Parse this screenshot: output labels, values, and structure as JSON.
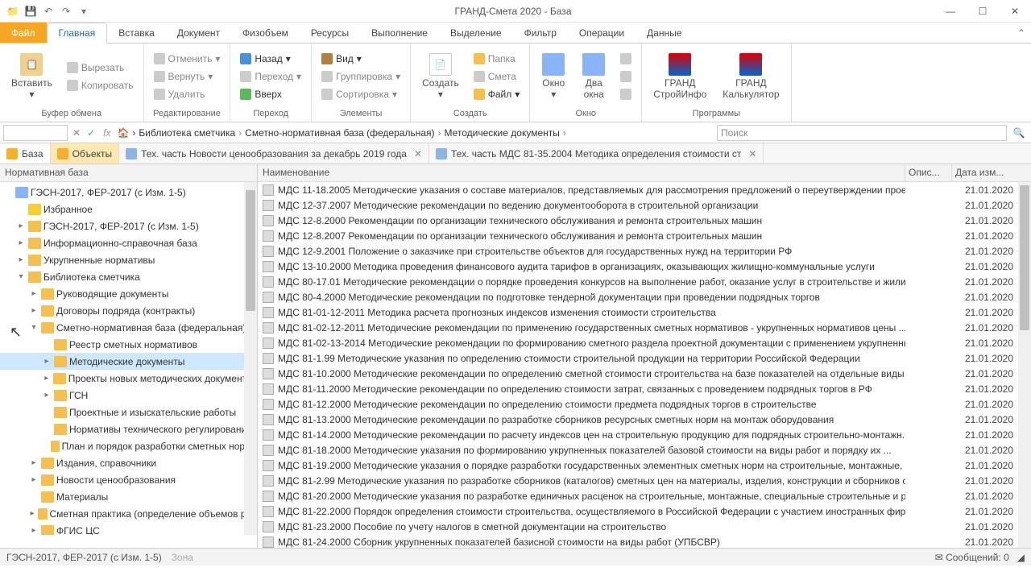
{
  "title": "ГРАНД-Смета 2020 - База",
  "ribbon_tabs": {
    "file": "Файл",
    "main": "Главная",
    "insert": "Вставка",
    "document": "Документ",
    "physvol": "Физобъем",
    "resources": "Ресурсы",
    "execute": "Выполнение",
    "select": "Выделение",
    "filter": "Фильтр",
    "ops": "Операции",
    "data": "Данные"
  },
  "ribbon": {
    "paste": "Вставить",
    "cut": "Вырезать",
    "copy": "Копировать",
    "clipboard": "Буфер обмена",
    "undo": "Отменить",
    "redo": "Вернуть",
    "delete": "Удалить",
    "editing": "Редактирование",
    "back": "Назад",
    "forward": "Переход",
    "up": "Вверх",
    "transfer": "Переход",
    "view": "Вид",
    "group": "Группировка",
    "sort": "Сортировка",
    "elements": "Элементы",
    "create": "Создать",
    "folder": "Папка",
    "smeta": "Смета",
    "file_btn": "Файл",
    "create_grp": "Создать",
    "window": "Окно",
    "two_win": "Два\nокна",
    "window_grp": "Окно",
    "grand_info": "ГРАНД\nСтройИнфо",
    "grand_calc": "ГРАНД\nКалькулятор",
    "programs": "Программы"
  },
  "breadcrumb": {
    "p1": "Библиотека сметчика",
    "p2": "Сметно-нормативная база (федеральная)",
    "p3": "Методические документы"
  },
  "search_placeholder": "Поиск",
  "view_tabs": {
    "base": "База",
    "objects": "Объекты"
  },
  "doc_tabs": {
    "t1": "Тех. часть Новости ценообразования за декабрь 2019 года",
    "t2": "Тех. часть МДС 81-35.2004 Методика определения стоимости ст"
  },
  "tree_header": "Нормативная база",
  "tree": [
    {
      "l": 0,
      "icon": "db",
      "exp": "",
      "t": "ГЭСН-2017, ФЕР-2017 (с Изм. 1-5)"
    },
    {
      "l": 1,
      "icon": "star",
      "exp": "",
      "t": "Избранное"
    },
    {
      "l": 1,
      "icon": "f",
      "exp": "▸",
      "t": "ГЭСН-2017, ФЕР-2017 (с Изм. 1-5)"
    },
    {
      "l": 1,
      "icon": "f",
      "exp": "▸",
      "t": "Информационно-справочная база"
    },
    {
      "l": 1,
      "icon": "f",
      "exp": "▸",
      "t": "Укрупненные нормативы"
    },
    {
      "l": 1,
      "icon": "f",
      "exp": "▾",
      "t": "Библиотека сметчика"
    },
    {
      "l": 2,
      "icon": "f",
      "exp": "▸",
      "t": "Руководящие документы"
    },
    {
      "l": 2,
      "icon": "f",
      "exp": "▸",
      "t": "Договоры подряда (контракты)"
    },
    {
      "l": 2,
      "icon": "f",
      "exp": "▾",
      "t": "Сметно-нормативная база (федеральная)",
      "sel": true
    },
    {
      "l": 3,
      "icon": "f",
      "exp": "",
      "t": "Реестр сметных нормативов"
    },
    {
      "l": 3,
      "icon": "f",
      "exp": "▸",
      "t": "Методические документы",
      "sel": true
    },
    {
      "l": 3,
      "icon": "f",
      "exp": "▸",
      "t": "Проекты новых методических документов"
    },
    {
      "l": 3,
      "icon": "f",
      "exp": "▸",
      "t": "ГСН"
    },
    {
      "l": 3,
      "icon": "f",
      "exp": "",
      "t": "Проектные и изыскательские работы"
    },
    {
      "l": 3,
      "icon": "f",
      "exp": "",
      "t": "Нормативы технического регулирования"
    },
    {
      "l": 3,
      "icon": "f",
      "exp": "",
      "t": "План и порядок разработки сметных норма"
    },
    {
      "l": 2,
      "icon": "f",
      "exp": "▸",
      "t": "Издания, справочники"
    },
    {
      "l": 2,
      "icon": "f",
      "exp": "▸",
      "t": "Новости ценообразования"
    },
    {
      "l": 2,
      "icon": "f",
      "exp": "",
      "t": "Материалы"
    },
    {
      "l": 2,
      "icon": "f",
      "exp": "▸",
      "t": "Сметная практика (определение объемов раб"
    },
    {
      "l": 2,
      "icon": "f",
      "exp": "▸",
      "t": "ФГИС ЦС"
    }
  ],
  "list_header": {
    "name": "Наименование",
    "desc": "Опис...",
    "date": "Дата изм..."
  },
  "rows": [
    {
      "n": "МДС 11-18.2005 Методические указания о составе материалов, представляемых для рассмотрения предложений о переутверждении проект...",
      "d": "21.01.2020"
    },
    {
      "n": "МДС 12-37.2007 Методические рекомендации по ведению документооборота в строительной организации",
      "d": "21.01.2020"
    },
    {
      "n": "МДС 12-8.2000 Рекомендации по организации технического обслуживания и ремонта строительных машин",
      "d": "21.01.2020"
    },
    {
      "n": "МДС 12-8.2007 Рекомендации по организации технического обслуживания и ремонта строительных машин",
      "d": "21.01.2020"
    },
    {
      "n": "МДС 12-9.2001 Положение о заказчике при строительстве объектов для государственных нужд на территории РФ",
      "d": "21.01.2020"
    },
    {
      "n": "МДС 13-10.2000 Методика проведения финансового аудита тарифов в организациях, оказывающих жилищно-коммунальные услуги",
      "d": "21.01.2020"
    },
    {
      "n": "МДС 80-17.01 Методические рекомендации о порядке проведения конкурсов на выполнение работ, оказание услуг в строительстве и жили...",
      "d": "21.01.2020"
    },
    {
      "n": "МДС 80-4.2000 Методические рекомендации по подготовке тендерной документации при проведении подрядных торгов",
      "d": "21.01.2020"
    },
    {
      "n": "МДС 81-01-12-2011 Методика расчета прогнозных индексов изменения стоимости строительства",
      "d": "21.01.2020"
    },
    {
      "n": "МДС 81-02-12-2011 Методические рекомендации по применению государственных сметных нормативов - укрупненных нормативов цены ...",
      "d": "21.01.2020"
    },
    {
      "n": "МДС 81-02-13-2014 Методические рекомендации по формированию сметного раздела проектной документации с применением укрупненных ...",
      "d": "21.01.2020"
    },
    {
      "n": "МДС 81-1.99 Методические указания по определению стоимости строительной продукции на территории Российской Федерации",
      "d": "21.01.2020"
    },
    {
      "n": "МДС 81-10.2000 Методические рекомендации по определению сметной стоимости строительства на базе показателей на отдельные виды р...",
      "d": "21.01.2020"
    },
    {
      "n": "МДС 81-11.2000 Методические рекомендации по определению стоимости затрат, связанных с проведением подрядных торгов в РФ",
      "d": "21.01.2020"
    },
    {
      "n": "МДС 81-12.2000 Методические рекомендации по определению стоимости предмета подрядных торгов в строительстве",
      "d": "21.01.2020"
    },
    {
      "n": "МДС 81-13.2000 Методические рекомендации по разработке сборников ресурсных сметных норм на монтаж оборудования",
      "d": "21.01.2020"
    },
    {
      "n": "МДС 81-14.2000 Методические рекомендации по расчету индексов цен на строительную продукцию для подрядных строительно-монтажн...",
      "d": "21.01.2020"
    },
    {
      "n": "МДС 81-18.2000 Методические указания по формированию укрупненных показателей базовой стоимости на виды работ и порядку их ...",
      "d": "21.01.2020"
    },
    {
      "n": "МДС 81-19.2000 Методические указания о порядке разработки государственных элементных сметных норм на строительные, монтажные, ...",
      "d": "21.01.2020"
    },
    {
      "n": "МДС 81-2.99 Методические указания по разработке сборников (каталогов) сметных цен на материалы, изделия, конструкции и сборников с...",
      "d": "21.01.2020"
    },
    {
      "n": "МДС 81-20.2000 Методические указания по разработке единичных расценок на строительные, монтажные, специальные строительные и ре...",
      "d": "21.01.2020"
    },
    {
      "n": "МДС 81-22.2000 Порядок определения стоимости строительства, осуществляемого в Российской Федерации с участием иностранных фирм",
      "d": "21.01.2020"
    },
    {
      "n": "МДС 81-23.2000 Пособие по учету налогов в сметной документации на строительство",
      "d": "21.01.2020"
    },
    {
      "n": "МДС 81-24.2000 Сборник укрупненных показателей базисной стоимости на виды работ (УПБСВР)",
      "d": "21.01.2020"
    }
  ],
  "status": {
    "left1": "ГЭСН-2017, ФЕР-2017 (с Изм. 1-5)",
    "left2": "Зона",
    "right": "Сообщений: 0"
  }
}
